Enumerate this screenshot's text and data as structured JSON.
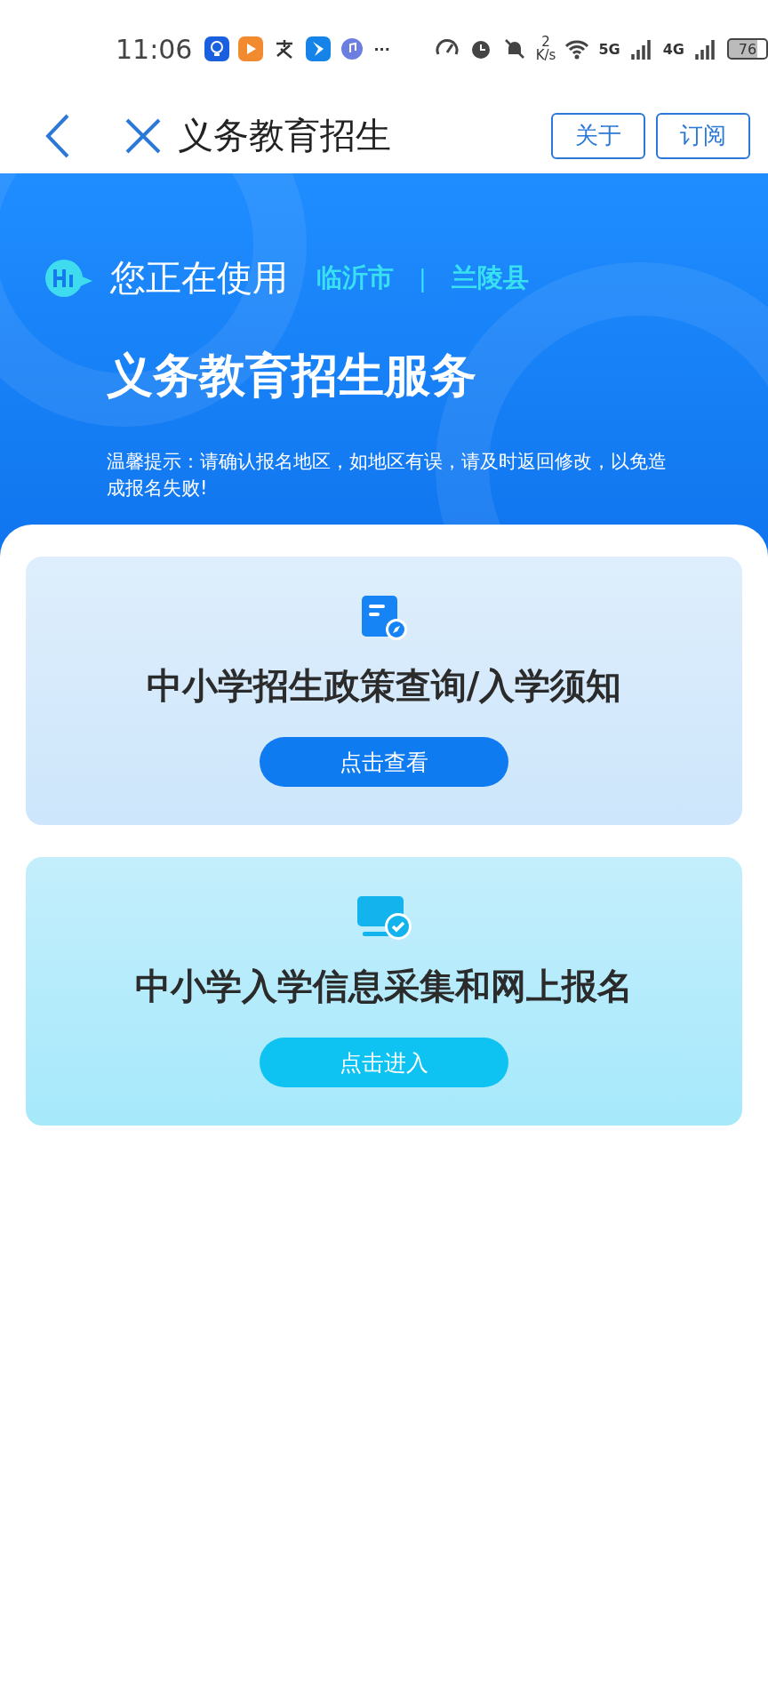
{
  "status_bar": {
    "time": "11:06",
    "more": "···",
    "speed_value": "2",
    "speed_unit": "K/s",
    "network_1": "5G",
    "network_2": "4G",
    "battery": "76"
  },
  "header": {
    "title": "义务教育招生",
    "buttons": [
      "关于",
      "订阅"
    ]
  },
  "banner": {
    "greeting": "您正在使用",
    "city": "临沂市",
    "separator": "|",
    "county": "兰陵县",
    "title": "义务教育招生服务",
    "tip": "温馨提示：请确认报名地区，如地区有误，请及时返回修改，以免造成报名失败!"
  },
  "cards": [
    {
      "kind": "policy",
      "title": "中小学招生政策查询/入学须知",
      "button": "点击查看"
    },
    {
      "kind": "signup",
      "title": "中小学入学信息采集和网上报名",
      "button": "点击进入"
    }
  ]
}
